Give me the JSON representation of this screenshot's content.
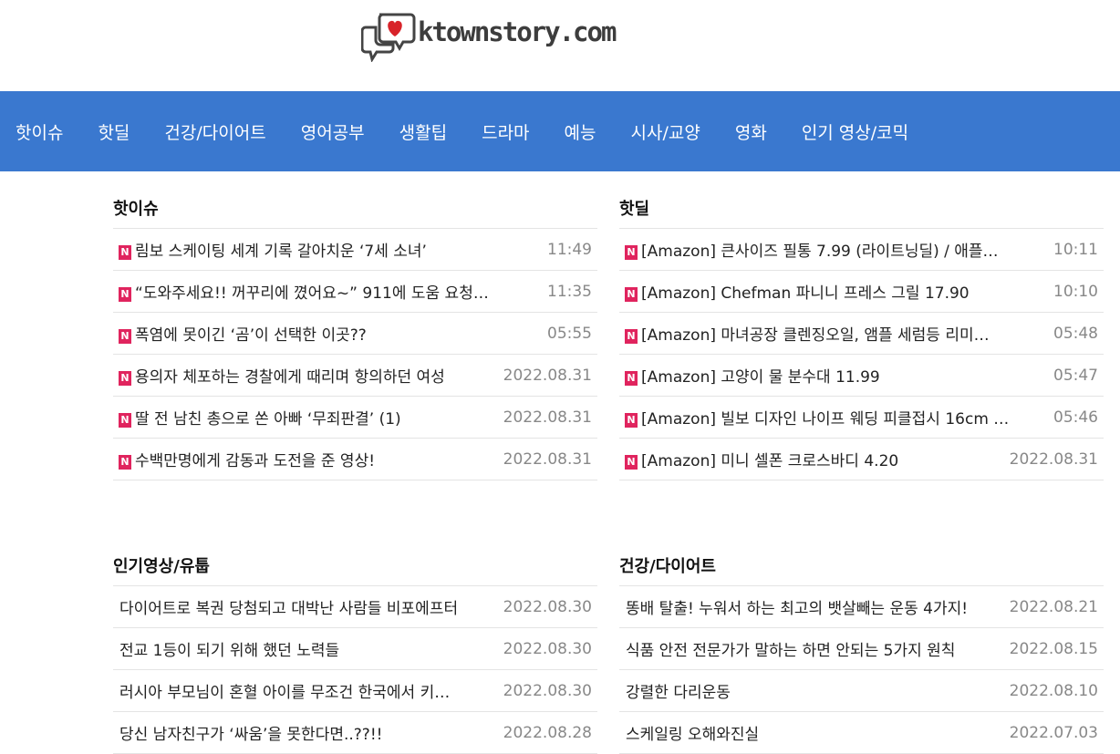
{
  "site": {
    "logo_text": "ktownstory.com"
  },
  "nav": [
    "핫이슈",
    "핫딜",
    "건강/다이어트",
    "영어공부",
    "생활팁",
    "드라마",
    "예능",
    "시사/교양",
    "영화",
    "인기 영상/코믹"
  ],
  "badge_label": "N",
  "colors": {
    "nav_bg": "#3a78cf",
    "badge_bg": "#e0245e"
  },
  "sections": {
    "hot_issue": {
      "title": "핫이슈",
      "items": [
        {
          "title": "림보 스케이팅 세계 기록 갈아치운 ‘7세 소녀’",
          "date": "11:49"
        },
        {
          "title": "“도와주세요!! 꺼꾸리에 꼈어요~” 911에 도움 요청…",
          "date": "11:35"
        },
        {
          "title": "폭염에 못이긴 ‘곰’이 선택한 이곳??",
          "date": "05:55"
        },
        {
          "title": "용의자 체포하는 경찰에게 때리며 항의하던 여성",
          "date": "2022.08.31"
        },
        {
          "title": "딸 전 남친 총으로 쏜 아빠 ‘무죄판결’ (1)",
          "date": "2022.08.31"
        },
        {
          "title": "수백만명에게 감동과 도전을 준 영상!",
          "date": "2022.08.31"
        }
      ]
    },
    "hot_deal": {
      "title": "핫딜",
      "items": [
        {
          "title": "[Amazon] 큰사이즈 필통 7.99 (라이트닝딜) / 애플…",
          "date": "10:11"
        },
        {
          "title": "[Amazon] Chefman 파니니 프레스 그릴 17.90",
          "date": "10:10"
        },
        {
          "title": "[Amazon] 마녀공장 클렌징오일, 앰플 세럼등 리미…",
          "date": "05:48"
        },
        {
          "title": "[Amazon] 고양이 물 분수대 11.99",
          "date": "05:47"
        },
        {
          "title": "[Amazon] 빌보 디자인 나이프 웨딩 피클접시 16cm …",
          "date": "05:46"
        },
        {
          "title": "[Amazon] 미니 셀폰 크로스바디 4.20",
          "date": "2022.08.31"
        }
      ]
    },
    "popular_video": {
      "title": "인기영상/유툽",
      "items": [
        {
          "title": "다이어트로 복권 당첨되고 대박난 사람들 비포에프터",
          "date": "2022.08.30"
        },
        {
          "title": "전교 1등이 되기 위해 했던 노력들",
          "date": "2022.08.30"
        },
        {
          "title": "러시아 부모님이 혼혈 아이를 무조건 한국에서 키…",
          "date": "2022.08.30"
        },
        {
          "title": "당신 남자친구가 ‘싸움’을 못한다면..??!!",
          "date": "2022.08.28"
        }
      ]
    },
    "health_diet": {
      "title": "건강/다이어트",
      "items": [
        {
          "title": "똥배 탈출! 누워서 하는 최고의 뱃살빼는 운동 4가지!",
          "date": "2022.08.21"
        },
        {
          "title": "식품 안전 전문가가 말하는 하면 안되는 5가지 원칙",
          "date": "2022.08.15"
        },
        {
          "title": "강렬한 다리운동",
          "date": "2022.08.10"
        },
        {
          "title": "스케일링 오해와진실",
          "date": "2022.07.03"
        }
      ]
    }
  }
}
